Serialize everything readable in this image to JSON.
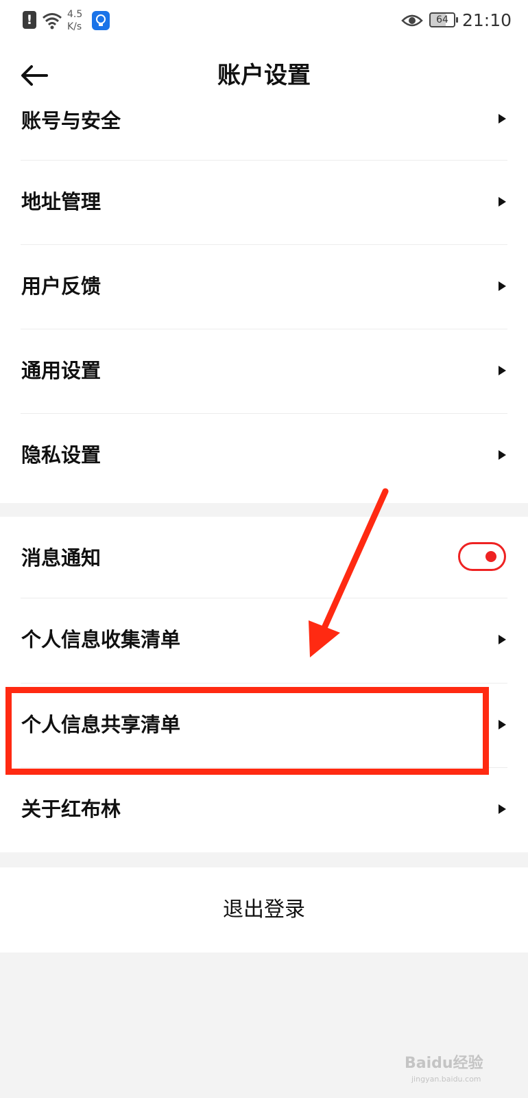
{
  "status_bar": {
    "alert_glyph": "!",
    "speed_value": "4.5",
    "speed_unit": "K/s",
    "battery": "64",
    "time": "21:10"
  },
  "header": {
    "title": "账户设置",
    "back_icon": "arrow-left-icon"
  },
  "group1": {
    "items": [
      {
        "label": "账号与安全"
      },
      {
        "label": "地址管理"
      },
      {
        "label": "用户反馈"
      },
      {
        "label": "通用设置"
      },
      {
        "label": "隐私设置"
      }
    ]
  },
  "group2": {
    "notification": {
      "label": "消息通知",
      "enabled": true
    },
    "items": [
      {
        "label": "个人信息收集清单"
      },
      {
        "label": "个人信息共享清单"
      },
      {
        "label": "关于红布林"
      }
    ]
  },
  "logout_label": "退出登录",
  "watermark": {
    "text": "Baidu经验",
    "sub": "jingyan.baidu.com"
  },
  "colors": {
    "accent": "#e22222",
    "annotation": "#ff2a12",
    "background": "#f3f3f3"
  }
}
